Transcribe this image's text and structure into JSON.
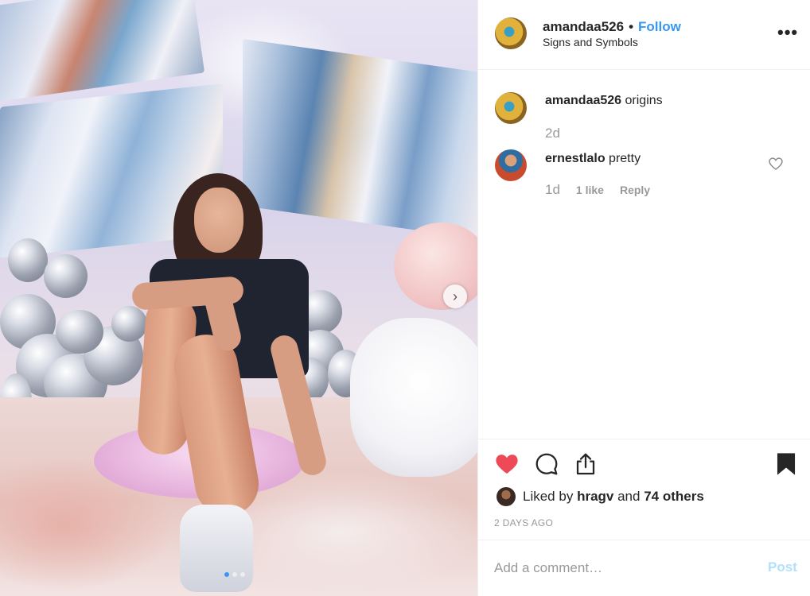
{
  "post": {
    "username": "amandaa526",
    "bullet": "•",
    "follow_label": "Follow",
    "location": "Signs and Symbols",
    "more_icon": "more-options-icon",
    "more_glyph": "•••"
  },
  "photo": {
    "next_glyph": "›",
    "carousel_dots": 3,
    "active_dot": 1
  },
  "comments": [
    {
      "username": "amandaa526",
      "text": "origins",
      "time": "2d"
    },
    {
      "username": "ernestlalo",
      "text": "pretty",
      "time": "1d",
      "likes": "1 like",
      "reply": "Reply"
    }
  ],
  "likes": {
    "prefix": "Liked by",
    "user": "hragv",
    "joiner": "and",
    "others": "74 others"
  },
  "date": "2 DAYS AGO",
  "add_comment": {
    "placeholder": "Add a comment…",
    "post_label": "Post"
  },
  "colors": {
    "link_blue": "#3897f0",
    "like_red": "#ed4956",
    "muted": "#999999",
    "post_disabled": "#b2dffc"
  }
}
